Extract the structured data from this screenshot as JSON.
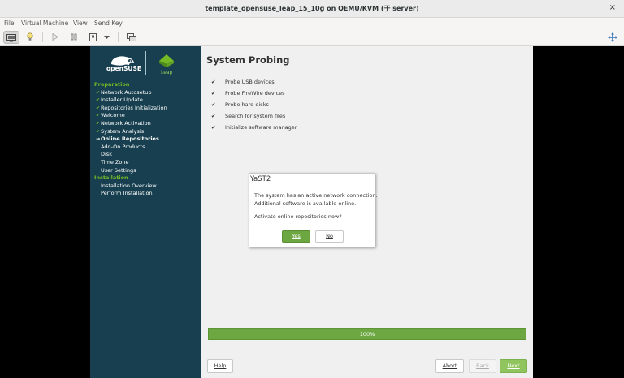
{
  "window": {
    "title": "template_opensuse_leap_15_10g on QEMU/KVM (于 server)",
    "close_glyph": "×"
  },
  "menubar": [
    "File",
    "Virtual Machine",
    "View",
    "Send Key"
  ],
  "toolbar": {
    "icons": [
      "console-icon",
      "lightbulb-icon",
      "play-icon",
      "pause-icon",
      "power-icon",
      "dropdown-icon",
      "snapshot-icon",
      "fullscreen-icon"
    ]
  },
  "sidebar": {
    "brand": "openSUSE",
    "product": "Leap",
    "sections": [
      {
        "header": "Preparation",
        "items": [
          {
            "label": "Network Autosetup",
            "state": "done"
          },
          {
            "label": "Installer Update",
            "state": "done"
          },
          {
            "label": "Repositories Initialization",
            "state": "done"
          },
          {
            "label": "Welcome",
            "state": "done"
          },
          {
            "label": "Network Activation",
            "state": "done"
          },
          {
            "label": "System Analysis",
            "state": "done"
          },
          {
            "label": "Online Repositories",
            "state": "current"
          },
          {
            "label": "Add-On Products",
            "state": "todo"
          },
          {
            "label": "Disk",
            "state": "todo"
          },
          {
            "label": "Time Zone",
            "state": "todo"
          },
          {
            "label": "User Settings",
            "state": "todo"
          }
        ]
      },
      {
        "header": "Installation",
        "items": [
          {
            "label": "Installation Overview",
            "state": "todo"
          },
          {
            "label": "Perform Installation",
            "state": "todo"
          }
        ]
      }
    ]
  },
  "main": {
    "title": "System Probing",
    "checkmark": "✔",
    "probes": [
      "Probe USB devices",
      "Probe FireWire devices",
      "Probe hard disks",
      "Search for system files",
      "Initialize software manager"
    ],
    "progress": {
      "label": "100%",
      "value": 1.0
    }
  },
  "dialog": {
    "title": "YaST2",
    "line1": "The system has an active network connection.",
    "line2": "Additional software is available online.",
    "question": "Activate online repositories now?",
    "yes_label": "Yes",
    "no_label": "No"
  },
  "buttons": {
    "help": "Help",
    "abort": "Abort",
    "back": "Back",
    "next": "Next"
  },
  "colors": {
    "sidebar_bg": "#173f4f",
    "accent_green": "#73ba25",
    "progress_green": "#6da741"
  }
}
